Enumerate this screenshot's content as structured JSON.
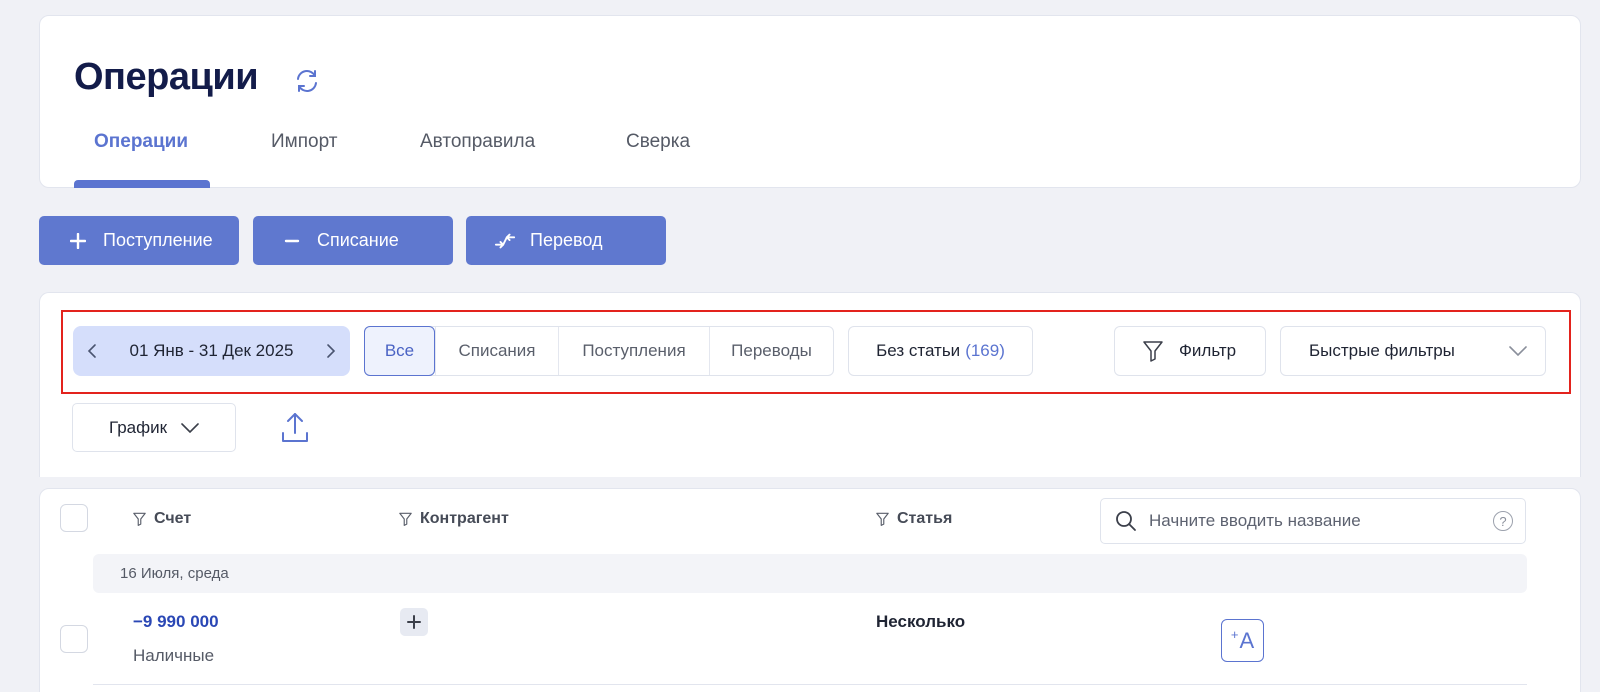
{
  "page": {
    "title": "Операции",
    "refresh_icon": "refresh-icon"
  },
  "tabs": [
    {
      "label": "Операции",
      "active": true
    },
    {
      "label": "Импорт",
      "active": false
    },
    {
      "label": "Автоправила",
      "active": false
    },
    {
      "label": "Сверка",
      "active": false
    }
  ],
  "actions": {
    "income": {
      "label": "Поступление",
      "icon": "plus-icon"
    },
    "expense": {
      "label": "Списание",
      "icon": "minus-icon"
    },
    "transfer": {
      "label": "Перевод",
      "icon": "transfer-arrows-icon"
    }
  },
  "filters": {
    "date_range": "01 Янв - 31 Дек 2025",
    "segments": [
      "Все",
      "Списания",
      "Поступления",
      "Переводы"
    ],
    "selected_segment": "Все",
    "no_category_label": "Без статьи",
    "no_category_count": "(169)",
    "filter_label": "Фильтр",
    "quick_filters_label": "Быстрые фильтры",
    "chart_label": "График"
  },
  "table": {
    "columns": {
      "account": "Счет",
      "counterparty": "Контрагент",
      "category": "Статья"
    },
    "search_placeholder": "Начните вводить название",
    "help_glyph": "?",
    "date_group": "16 Июля, среда",
    "rows": [
      {
        "amount": "−9 990 000",
        "account": "Наличные",
        "category": "Несколько",
        "ai_glyph": "A",
        "ai_sup": "+"
      }
    ]
  },
  "colors": {
    "accent": "#5b74d0",
    "highlight": "#e3231d",
    "amount": "#2a47b5"
  }
}
